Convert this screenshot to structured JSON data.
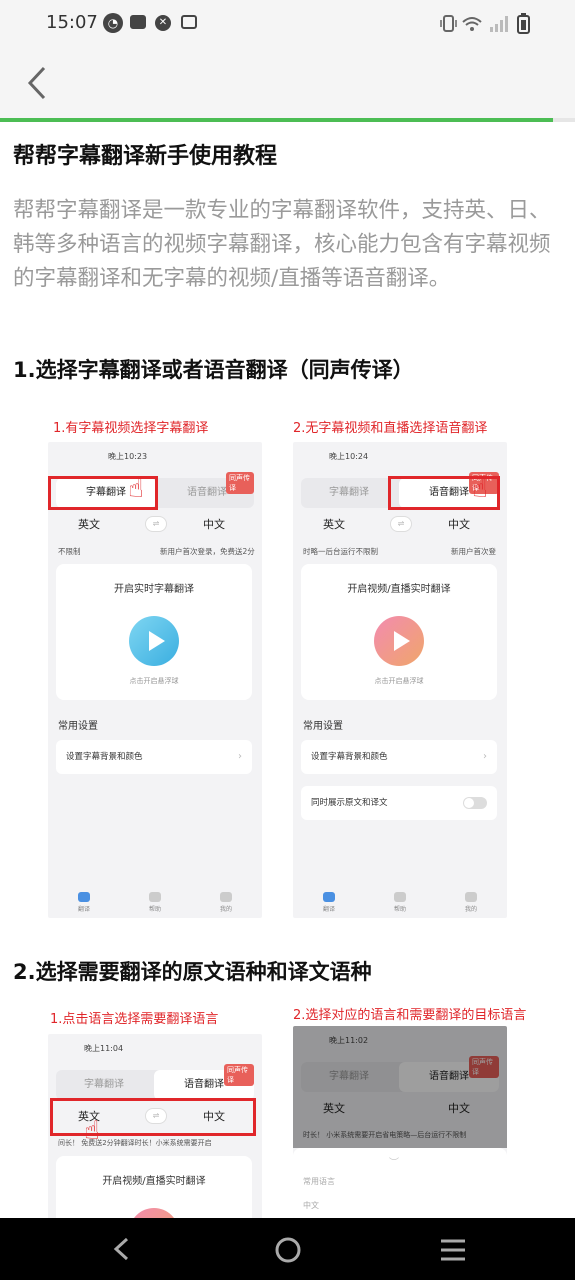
{
  "status_bar": {
    "time": "15:07"
  },
  "article": {
    "title": "帮帮字幕翻译新手使用教程",
    "intro": "帮帮字幕翻译是一款专业的字幕翻译软件，支持英、日、韩等多种语言的视频字幕翻译，核心能力包含有字幕视频的字幕翻译和无字幕的视频/直播等语音翻译。",
    "section1_heading": "1.选择字幕翻译或者语音翻译（同声传译）",
    "section2_heading": "2.选择需要翻译的原文语种和译文语种"
  },
  "figure1": {
    "caption_left": "1.有字幕视频选择字幕翻译",
    "caption_right": "2.无字幕视频和直播选择语音翻译",
    "left": {
      "time": "晚上10:23",
      "tab_subtitle": "字幕翻译",
      "tab_voice": "语音翻译",
      "badge": "同声传译",
      "lang_from": "英文",
      "lang_to": "中文",
      "swap": "⇌",
      "note_left": "不限制",
      "note_right": "新用户首次登录，免费送2分",
      "card_title": "开启实时字幕翻译",
      "card_hint": "点击开启悬浮球",
      "section": "常用设置",
      "row1": "设置字幕背景和颜色",
      "nav": [
        "翻译",
        "帮助",
        "我的"
      ]
    },
    "right": {
      "time": "晚上10:24",
      "tab_subtitle": "字幕翻译",
      "tab_voice": "语音翻译",
      "badge": "同声传译",
      "lang_from": "英文",
      "lang_to": "中文",
      "swap": "⇌",
      "note_left": "时略一后台运行不限制",
      "note_right": "新用户首次登",
      "card_title": "开启视频/直播实时翻译",
      "card_hint": "点击开启悬浮球",
      "section": "常用设置",
      "row1": "设置字幕背景和颜色",
      "row2": "同时展示原文和译文",
      "nav": [
        "翻译",
        "帮助",
        "我的"
      ]
    }
  },
  "figure2": {
    "caption_left": "1.点击语言选择需要翻译语言",
    "caption_right": "2.选择对应的语言和需要翻译的目标语言",
    "left": {
      "time": "晚上11:04",
      "tab_subtitle": "字幕翻译",
      "tab_voice": "语音翻译",
      "badge": "同声传译",
      "lang_from": "英文",
      "lang_to": "中文",
      "swap": "⇌",
      "note": "间长！ 免费送2分钟翻译时长！小米系统需要开启",
      "card_title": "开启视频/直播实时翻译"
    },
    "right": {
      "time": "晚上11:02",
      "tab_subtitle": "字幕翻译",
      "tab_voice": "语音翻译",
      "badge": "同声传译",
      "lang_from": "英文",
      "lang_to": "中文",
      "note": "时长！ 小米系统需要开启省电策略—后台运行不限制",
      "sheet_label1": "常用语言",
      "sheet_label2": "中文"
    }
  },
  "colors": {
    "accent_green": "#4cbd54",
    "highlight_red": "#e0262a"
  }
}
